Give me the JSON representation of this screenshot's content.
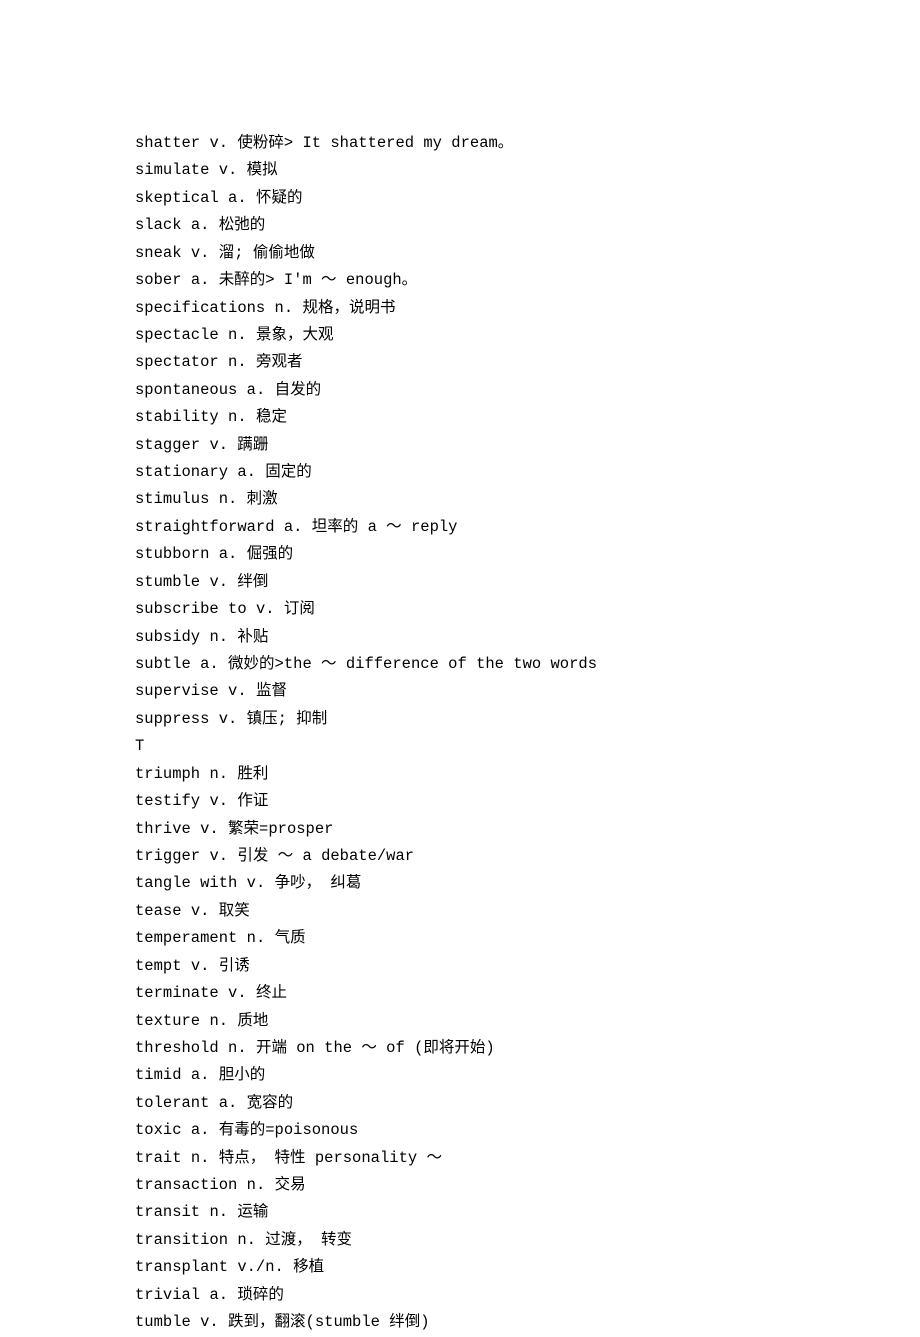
{
  "entries": [
    {
      "word": "shatter",
      "pos": "v.",
      "def": "使粉碎> It shattered my dream。"
    },
    {
      "word": "simulate",
      "pos": "v.",
      "def": "模拟"
    },
    {
      "word": "skeptical",
      "pos": "a.",
      "def": "怀疑的"
    },
    {
      "word": "slack",
      "pos": "a.",
      "def": "松弛的"
    },
    {
      "word": "sneak",
      "pos": "v.",
      "def": "溜; 偷偷地做"
    },
    {
      "word": "sober",
      "pos": "a.",
      "def": "未醉的> I'm ～ enough。"
    },
    {
      "word": "specifications",
      "pos": "n.",
      "def": "规格，说明书"
    },
    {
      "word": "spectacle",
      "pos": "n.",
      "def": "景象，大观"
    },
    {
      "word": "spectator",
      "pos": "n.",
      "def": "旁观者"
    },
    {
      "word": "spontaneous",
      "pos": "a.",
      "def": "自发的"
    },
    {
      "word": "stability",
      "pos": "n.",
      "def": "稳定"
    },
    {
      "word": "stagger",
      "pos": "v.",
      "def": "蹒跚"
    },
    {
      "word": "stationary",
      "pos": "a.",
      "def": "固定的"
    },
    {
      "word": "stimulus",
      "pos": "n.",
      "def": "刺激"
    },
    {
      "word": "straightforward",
      "pos": "a.",
      "def": "坦率的 a ～ reply"
    },
    {
      "word": "stubborn",
      "pos": "a.",
      "def": "倔强的"
    },
    {
      "word": "stumble",
      "pos": "v.",
      "def": "绊倒"
    },
    {
      "word": "subscribe to",
      "pos": "v.",
      "def": "订阅"
    },
    {
      "word": "subsidy",
      "pos": "n.",
      "def": "补贴"
    },
    {
      "word": "subtle",
      "pos": "a.",
      "def": "微妙的>the ～ difference of the two words"
    },
    {
      "word": "supervise",
      "pos": "v.",
      "def": "监督"
    },
    {
      "word": "suppress",
      "pos": "v.",
      "def": "镇压; 抑制"
    },
    {
      "word": "T",
      "pos": "",
      "def": ""
    },
    {
      "word": "triumph",
      "pos": "n.",
      "def": "胜利"
    },
    {
      "word": "testify",
      "pos": "v.",
      "def": "作证"
    },
    {
      "word": "thrive",
      "pos": "v.",
      "def": "繁荣=prosper"
    },
    {
      "word": "trigger",
      "pos": "v.",
      "def": "引发 ～ a debate/war"
    },
    {
      "word": "tangle with",
      "pos": "v.",
      "def": "争吵， 纠葛"
    },
    {
      "word": "tease",
      "pos": "v.",
      "def": "取笑"
    },
    {
      "word": "temperament",
      "pos": "n.",
      "def": "气质"
    },
    {
      "word": "tempt",
      "pos": "v.",
      "def": "引诱"
    },
    {
      "word": "terminate",
      "pos": "v.",
      "def": "终止"
    },
    {
      "word": "texture",
      "pos": "n.",
      "def": "质地"
    },
    {
      "word": "threshold",
      "pos": "n.",
      "def": "开端 on the ～ of (即将开始)"
    },
    {
      "word": "timid",
      "pos": "a.",
      "def": "胆小的"
    },
    {
      "word": "tolerant",
      "pos": "a.",
      "def": "宽容的"
    },
    {
      "word": "toxic",
      "pos": "a.",
      "def": "有毒的=poisonous"
    },
    {
      "word": "trait",
      "pos": "n.",
      "def": "特点， 特性 personality ～"
    },
    {
      "word": "transaction",
      "pos": "n.",
      "def": "交易"
    },
    {
      "word": "transit",
      "pos": "n.",
      "def": "运输"
    },
    {
      "word": "transition",
      "pos": "n.",
      "def": "过渡， 转变"
    },
    {
      "word": "transplant",
      "pos": "v./n.",
      "def": "移植"
    },
    {
      "word": "trivial",
      "pos": "a.",
      "def": "琐碎的"
    },
    {
      "word": "tumble",
      "pos": "v.",
      "def": "跌到，翻滚(stumble 绊倒)"
    }
  ]
}
